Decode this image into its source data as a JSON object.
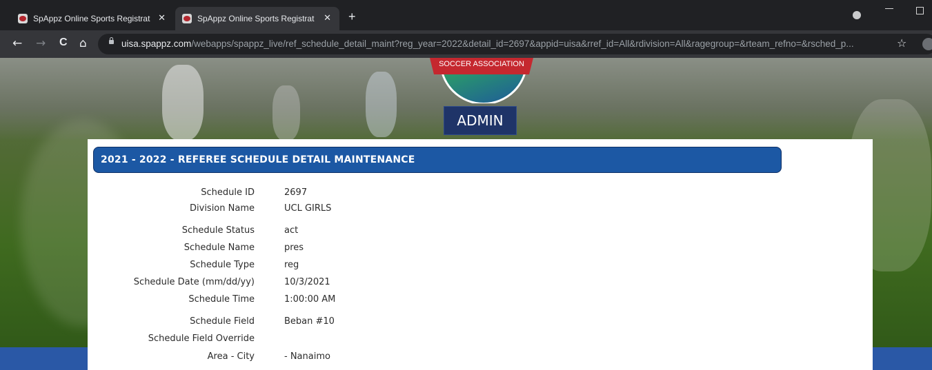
{
  "browser": {
    "tabs": [
      {
        "title": "SpAppz Online Sports Registratio",
        "close": "✕"
      },
      {
        "title": "SpAppz Online Sports Registratio",
        "close": "✕"
      }
    ],
    "new_tab": "+",
    "nav": {
      "back": "←",
      "forward": "→",
      "reload": "C",
      "home": "⌂"
    },
    "url_host": "uisa.spappz.com",
    "url_path": "/webapps/spappz_live/ref_schedule_detail_maint?reg_year=2022&detail_id=2697&appid=uisa&rref_id=All&rdivision=All&ragegroup=&rteam_refno=&rsched_p...",
    "bookmark": "☆"
  },
  "header": {
    "logo_text": "SOCCER ASSOCIATION",
    "admin_label": "ADMIN"
  },
  "panel": {
    "title": "2021 - 2022 - REFEREE SCHEDULE DETAIL MAINTENANCE",
    "fields": [
      {
        "label": "Schedule ID",
        "value": "2697"
      },
      {
        "label": "Division Name",
        "value": "UCL GIRLS"
      },
      {
        "label": "Schedule Status",
        "value": "act"
      },
      {
        "label": "Schedule Name",
        "value": "pres"
      },
      {
        "label": "Schedule Type",
        "value": "reg"
      },
      {
        "label": "Schedule Date (mm/dd/yy)",
        "value": "10/3/2021"
      },
      {
        "label": "Schedule Time",
        "value": "1:00:00 AM"
      },
      {
        "label": "Schedule Field",
        "value": "Beban #10"
      },
      {
        "label": "Schedule Field Override",
        "value": ""
      },
      {
        "label": "Area - City",
        "value": "- Nanaimo"
      }
    ]
  },
  "colors": {
    "header_blue": "#1c58a4",
    "admin_navy": "#1f3468",
    "footer_blue": "#2a58a6"
  }
}
